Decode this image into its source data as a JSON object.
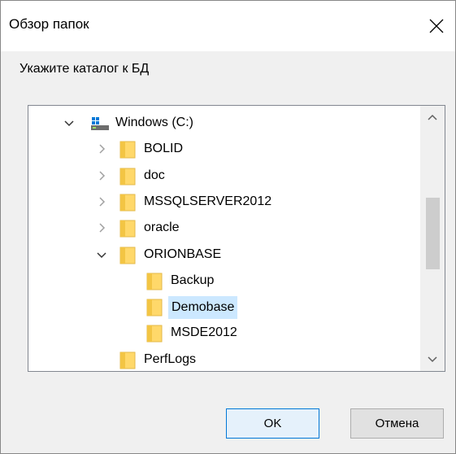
{
  "window": {
    "title": "Обзор папок",
    "close_icon": "close-icon"
  },
  "prompt": "Укажите каталог к БД",
  "tree": {
    "items": [
      {
        "label": "Windows (C:)",
        "icon": "drive-icon",
        "expander": "expanded",
        "level": 0
      },
      {
        "label": "BOLID",
        "icon": "folder-icon",
        "expander": "collapsed",
        "level": 1
      },
      {
        "label": "doc",
        "icon": "folder-icon",
        "expander": "collapsed",
        "level": 1
      },
      {
        "label": "MSSQLSERVER2012",
        "icon": "folder-icon",
        "expander": "collapsed",
        "level": 1
      },
      {
        "label": "oracle",
        "icon": "folder-icon",
        "expander": "collapsed",
        "level": 1
      },
      {
        "label": "ORIONBASE",
        "icon": "folder-icon",
        "expander": "expanded",
        "level": 1
      },
      {
        "label": "Backup",
        "icon": "folder-icon",
        "expander": "none",
        "level": 2
      },
      {
        "label": "Demobase",
        "icon": "folder-icon",
        "expander": "none",
        "level": 2,
        "selected": true
      },
      {
        "label": "MSDE2012",
        "icon": "folder-icon",
        "expander": "none",
        "level": 2
      },
      {
        "label": "PerfLogs",
        "icon": "folder-icon",
        "expander": "none",
        "level": 1
      }
    ]
  },
  "buttons": {
    "ok": "OK",
    "cancel": "Отмена"
  },
  "colors": {
    "selection": "#cce8ff",
    "folder": "#ffd86a",
    "accent": "#0078d7"
  }
}
